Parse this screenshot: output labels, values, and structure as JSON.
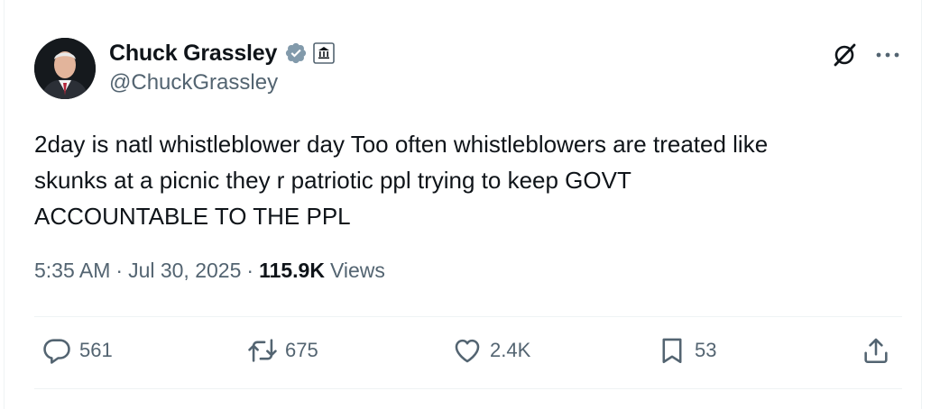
{
  "author": {
    "name": "Chuck Grassley",
    "handle": "@ChuckGrassley"
  },
  "tweet": {
    "text": "2day is natl whistleblower day Too often whistleblowers are treated like\nskunks at a picnic they r patriotic ppl trying to keep GOVT\nACCOUNTABLE TO THE PPL"
  },
  "meta": {
    "time": "5:35 AM",
    "separator": "·",
    "date": "Jul 30, 2025",
    "views_count": "115.9K",
    "views_label": "Views"
  },
  "actions": {
    "replies": "561",
    "reposts": "675",
    "likes": "2.4K",
    "bookmarks": "53"
  },
  "icons": {
    "verified": "verified-badge-icon",
    "affiliation": "government-building-icon",
    "grok": "grok-icon",
    "more": "more-icon",
    "reply": "reply-icon",
    "repost": "repost-icon",
    "like": "heart-icon",
    "bookmark": "bookmark-icon",
    "share": "share-icon"
  },
  "colors": {
    "text": "#0f1419",
    "secondary": "#536471",
    "verified_grey": "#829aab"
  }
}
